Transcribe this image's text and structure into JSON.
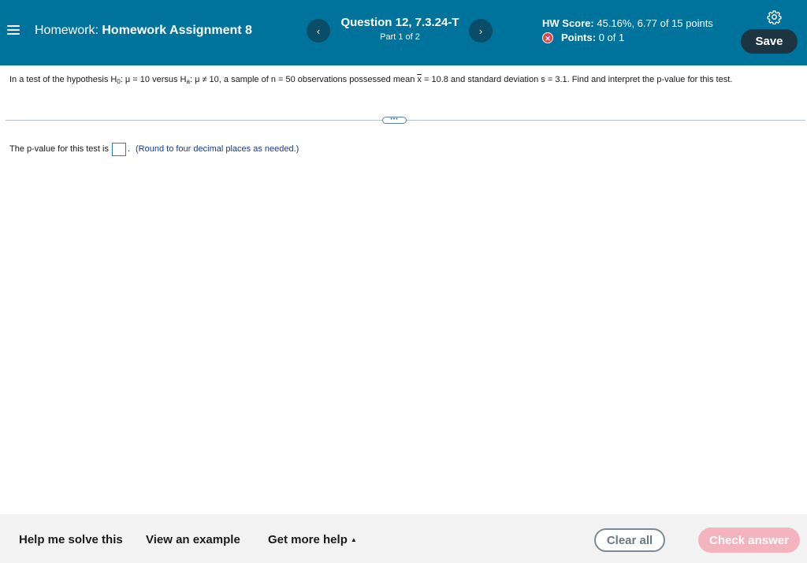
{
  "header": {
    "homework_prefix": "Homework:",
    "homework_name": "Homework Assignment 8",
    "question_title": "Question 12, 7.3.24-T",
    "question_part": "Part 1 of 2",
    "prev_label": "‹",
    "next_label": "›",
    "hw_score_label": "HW Score:",
    "hw_score_value": "45.16%, 6.77 of 15 points",
    "points_label": "Points:",
    "points_value": "0 of 1",
    "save_label": "Save",
    "colors": {
      "bar": "#00739d",
      "save": "#1d3441",
      "points_icon": "#e0434c"
    }
  },
  "question": {
    "p1": "In a test of the hypothesis H",
    "sub0": "0",
    "p2": ": μ = 10 versus H",
    "suba": "a",
    "p3": ": μ ≠ 10, a sample of n = 50 observations possessed mean ",
    "xbar": "x",
    "p4": " = 10.8 and standard deviation s = 3.1. Find and interpret the p-value for this test."
  },
  "more_button_label": "•••",
  "answer": {
    "prefix": "The p-value for this test is",
    "suffix": ".",
    "value": "",
    "hint": "(Round to four decimal places as needed.)"
  },
  "footer": {
    "help_label": "Help me solve this",
    "example_label": "View an example",
    "more_help_label": "Get more help",
    "more_help_caret": "▲",
    "clear_label": "Clear all",
    "check_label": "Check answer"
  }
}
